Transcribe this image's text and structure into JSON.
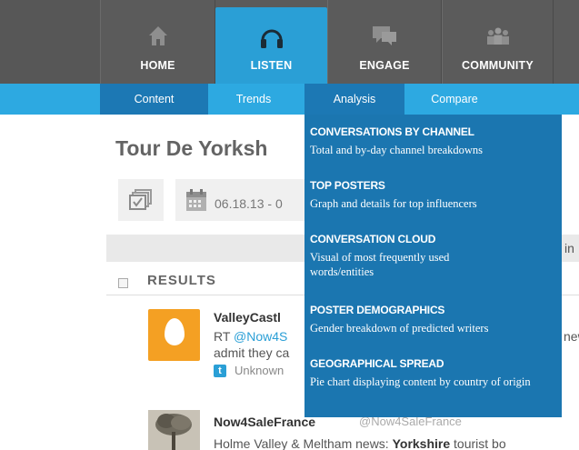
{
  "top_nav": {
    "items": [
      {
        "label": "HOME",
        "icon": "home-icon"
      },
      {
        "label": "LISTEN",
        "icon": "headphones-icon",
        "active": true
      },
      {
        "label": "ENGAGE",
        "icon": "chat-bubbles-icon"
      },
      {
        "label": "COMMUNITY",
        "icon": "people-icon"
      }
    ]
  },
  "sub_nav": {
    "items": [
      {
        "label": "Content"
      },
      {
        "label": "Trends"
      },
      {
        "label": "Analysis",
        "active": true
      },
      {
        "label": "Compare"
      }
    ]
  },
  "page": {
    "title": "Tour De Yorksh",
    "date_range": "06.18.13 - 0",
    "in_label": "in",
    "results_label": "RESULTS"
  },
  "results": [
    {
      "poster": "ValleyCastl",
      "text_prefix": "RT ",
      "mention": "@Now4S",
      "text_cut": "new",
      "line2": "admit they ca",
      "source": "Unknown"
    },
    {
      "poster": "Now4SaleFrance",
      "handle": "@Now4SaleFrance",
      "text_before": "Holme Valley & Meltham news: ",
      "text_bold": "Yorkshire",
      "text_after": " tourist bo"
    }
  ],
  "analysis_menu": {
    "items": [
      {
        "title": "CONVERSATIONS BY CHANNEL",
        "desc": "Total and by-day channel breakdowns"
      },
      {
        "title": "TOP POSTERS",
        "desc": "Graph and details for top influencers"
      },
      {
        "title": "CONVERSATION CLOUD",
        "desc": "Visual of most frequently used words/entities"
      },
      {
        "title": "POSTER DEMOGRAPHICS",
        "desc": "Gender breakdown of predicted writers"
      },
      {
        "title": "GEOGRAPHICAL SPREAD",
        "desc": "Pie chart displaying content by country of origin"
      }
    ]
  },
  "colors": {
    "nav_bg": "#5b5b5b",
    "accent": "#2a9fd6",
    "subnav_bg": "#2da9e1",
    "dropdown_bg": "#1b76b0"
  }
}
